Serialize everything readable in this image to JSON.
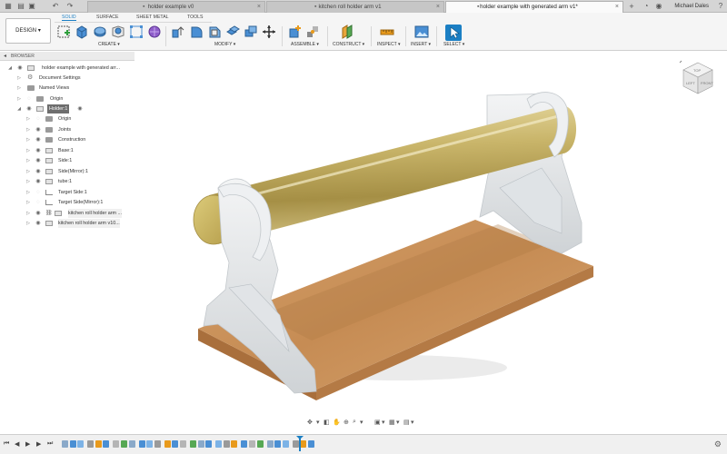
{
  "tabs": [
    {
      "label": "holder example v0"
    },
    {
      "label": "kitchen roll holder arm v1"
    },
    {
      "label": "holder example with generated arm v1*"
    }
  ],
  "user": {
    "name": "Michael Dales"
  },
  "toolbar": {
    "design_label": "DESIGN",
    "workspace_tabs": [
      "SOLID",
      "SURFACE",
      "SHEET METAL",
      "TOOLS"
    ],
    "groups": [
      "CREATE",
      "MODIFY",
      "ASSEMBLE",
      "CONSTRUCT",
      "INSPECT",
      "INSERT",
      "SELECT"
    ]
  },
  "browser": {
    "header": "BROWSER",
    "items": [
      {
        "label": "holder example with generated arr..."
      },
      {
        "label": "Document Settings"
      },
      {
        "label": "Named Views"
      },
      {
        "label": "Origin"
      },
      {
        "label": "Holder:1"
      },
      {
        "label": "Origin"
      },
      {
        "label": "Joints"
      },
      {
        "label": "Construction"
      },
      {
        "label": "Base:1"
      },
      {
        "label": "Side:1"
      },
      {
        "label": "Side(Mirror):1"
      },
      {
        "label": "tube:1"
      },
      {
        "label": "Target Side:1"
      },
      {
        "label": "Target Side(Mirror):1"
      },
      {
        "label": "kitchen roll holder arm ..."
      },
      {
        "label": "kitchen roll holder arm v10..."
      }
    ]
  },
  "viewcube": {
    "top": "TOP",
    "left": "LEFT",
    "front": "FRONT"
  },
  "colors": {
    "accent": "#1b7fc4",
    "tube": "#c9b76a",
    "base": "#c98f5a",
    "arm": "#e4e7ea"
  }
}
